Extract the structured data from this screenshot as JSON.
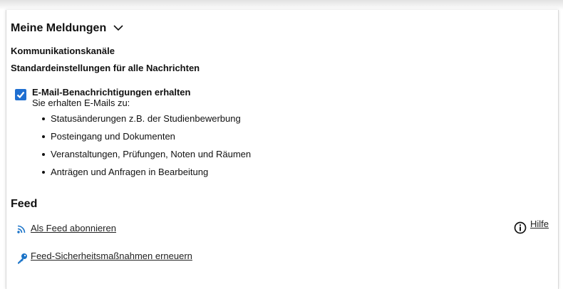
{
  "meldungen": {
    "title": "Meine Meldungen",
    "channels_heading": "Kommunikationskanäle",
    "defaults_heading": "Standardeinstellungen für alle Nachrichten",
    "email_checkbox": {
      "label": "E-Mail-Benachrichtigungen erhalten",
      "checked": true,
      "description": "Sie erhalten E-Mails zu:",
      "items": [
        "Statusänderungen z.B. der Studienbewerbung",
        "Posteingang und Dokumenten",
        "Veranstaltungen, Prüfungen, Noten und Räumen",
        "Anträgen und Anfragen in Bearbeitung"
      ]
    }
  },
  "feed": {
    "title": "Feed",
    "subscribe_label": "Als Feed abonnieren",
    "renew_label": "Feed-Sicherheitsmaßnahmen erneuern",
    "help_label": "Hilfe"
  },
  "colors": {
    "accent": "#1f6fd1",
    "rss": "#1a73c8",
    "key": "#1a73c8"
  },
  "icons": {
    "chevron": "chevron-down-icon",
    "check": "checkmark-icon",
    "rss": "rss-icon",
    "key": "key-icon",
    "help": "info-circle-icon"
  }
}
